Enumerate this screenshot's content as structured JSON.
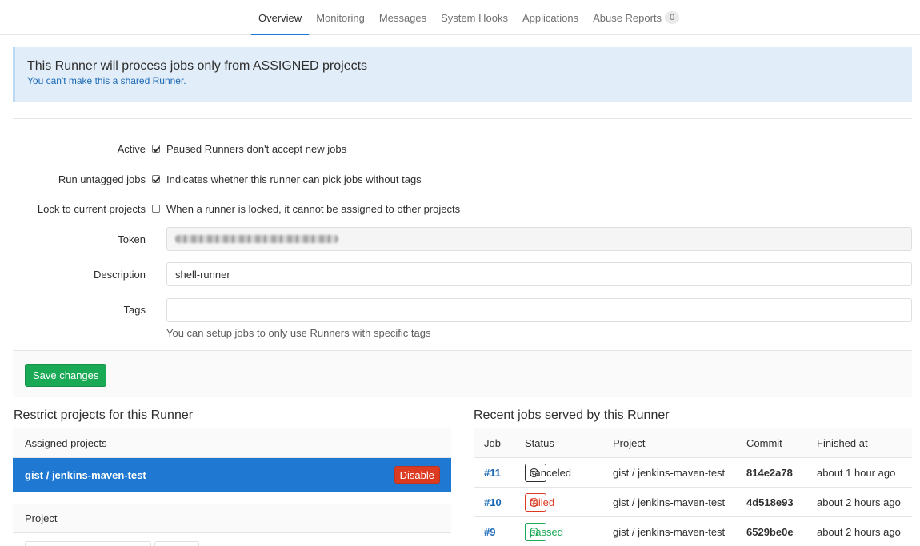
{
  "nav": {
    "tabs": [
      {
        "label": "Overview",
        "active": true
      },
      {
        "label": "Monitoring"
      },
      {
        "label": "Messages"
      },
      {
        "label": "System Hooks"
      },
      {
        "label": "Applications"
      },
      {
        "label": "Abuse Reports",
        "badge": "0"
      }
    ]
  },
  "banner": {
    "title": "This Runner will process jobs only from ASSIGNED projects",
    "subtitle": "You can't make this a shared Runner."
  },
  "form": {
    "active": {
      "label": "Active",
      "checked": true,
      "help": "Paused Runners don't accept new jobs"
    },
    "run_untagged": {
      "label": "Run untagged jobs",
      "checked": true,
      "help": "Indicates whether this runner can pick jobs without tags"
    },
    "lock": {
      "label": "Lock to current projects",
      "checked": false,
      "help": "When a runner is locked, it cannot be assigned to other projects"
    },
    "token": {
      "label": "Token"
    },
    "description": {
      "label": "Description",
      "value": "shell-runner"
    },
    "tags": {
      "label": "Tags",
      "value": "",
      "hint": "You can setup jobs to only use Runners with specific tags"
    },
    "save_label": "Save changes"
  },
  "restrict": {
    "title": "Restrict projects for this Runner",
    "assigned_header": "Assigned projects",
    "assigned": [
      {
        "name": "gist / jenkins-maven-test",
        "action": "Disable"
      }
    ],
    "project_header": "Project"
  },
  "jobs": {
    "title": "Recent jobs served by this Runner",
    "columns": [
      "Job",
      "Status",
      "Project",
      "Commit",
      "Finished at"
    ],
    "rows": [
      {
        "id": "#11",
        "status": "canceled",
        "status_icon": "⊘",
        "project": "gist / jenkins-maven-test",
        "commit": "814e2a78",
        "finished": "about 1 hour ago"
      },
      {
        "id": "#10",
        "status": "failed",
        "status_icon": "✕",
        "project": "gist / jenkins-maven-test",
        "commit": "4d518e93",
        "finished": "about 2 hours ago"
      },
      {
        "id": "#9",
        "status": "passed",
        "status_icon": "✓",
        "project": "gist / jenkins-maven-test",
        "commit": "6529be0e",
        "finished": "about 2 hours ago"
      }
    ]
  },
  "colors": {
    "accent": "#1f78d1",
    "success": "#1aaa55",
    "danger": "#db3b21",
    "info_bg": "#e1edf8"
  }
}
